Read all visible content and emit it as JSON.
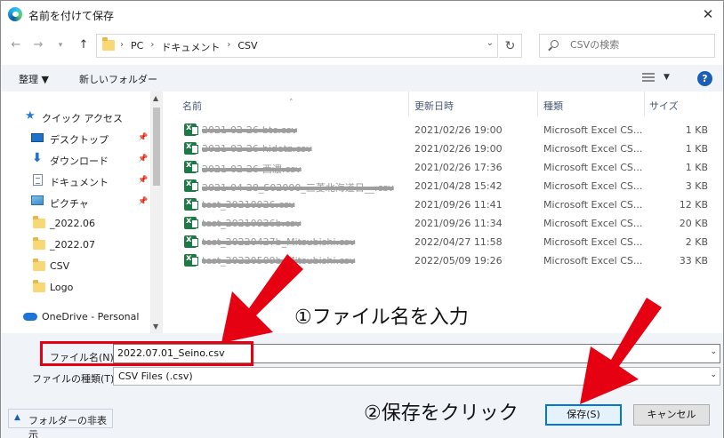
{
  "window": {
    "title": "名前を付けて保存"
  },
  "address": {
    "crumbs": [
      "PC",
      "ドキュメント",
      "CSV"
    ]
  },
  "search": {
    "placeholder": "CSVの検索"
  },
  "toolbar": {
    "organize": "整理 ▼",
    "new_folder": "新しいフォルダー"
  },
  "nav": {
    "quick_access": "クイック アクセス",
    "items": [
      {
        "label": "デスクトップ",
        "icon": "desktop-icon",
        "pinned": true
      },
      {
        "label": "ダウンロード",
        "icon": "download-icon",
        "pinned": true
      },
      {
        "label": "ドキュメント",
        "icon": "document-icon",
        "pinned": true
      },
      {
        "label": "ピクチャ",
        "icon": "pictures-icon",
        "pinned": true
      },
      {
        "label": "_2022.06",
        "icon": "folder-icon",
        "pinned": false
      },
      {
        "label": "_2022.07",
        "icon": "folder-icon",
        "pinned": false
      },
      {
        "label": "CSV",
        "icon": "folder-icon",
        "pinned": false
      },
      {
        "label": "Logo",
        "icon": "folder-icon",
        "pinned": false
      }
    ],
    "onedrive": "OneDrive - Personal"
  },
  "columns": {
    "name": "名前",
    "date": "更新日時",
    "type": "種類",
    "size": "サイズ"
  },
  "files": [
    {
      "name": "2021-02-26-btc.csv",
      "date": "2021/02/26 19:00",
      "type": "Microsoft Excel CS...",
      "size": "1 KB"
    },
    {
      "name": "2021-02-26-hidetz.csv",
      "date": "2021/02/26 19:00",
      "type": "Microsoft Excel CS...",
      "size": "1 KB"
    },
    {
      "name": "2021-02-26-西濃.csv",
      "date": "2021/02/26 17:36",
      "type": "Microsoft Excel CS...",
      "size": "1 KB"
    },
    {
      "name": "2021-04-28_S02000_三菱北海道日__.csv",
      "date": "2021/04/28 15:42",
      "type": "Microsoft Excel CS...",
      "size": "3 KB"
    },
    {
      "name": "test_20210926.csv",
      "date": "2021/09/26 11:41",
      "type": "Microsoft Excel CS...",
      "size": "12 KB"
    },
    {
      "name": "test_20210926b.csv",
      "date": "2021/09/26 11:34",
      "type": "Microsoft Excel CS...",
      "size": "20 KB"
    },
    {
      "name": "test_20220427b_Mitsubishi.csv",
      "date": "2022/04/27 11:58",
      "type": "Microsoft Excel CS...",
      "size": "2 KB"
    },
    {
      "name": "test_20220509b_Mitsubishi.csv",
      "date": "2022/05/09 19:26",
      "type": "Microsoft Excel CS...",
      "size": "33 KB"
    }
  ],
  "form": {
    "filename_label": "ファイル名(N):",
    "filename_value": "2022.07.01_Seino.csv",
    "filetype_label": "ファイルの種類(T):",
    "filetype_value": "CSV Files (.csv)"
  },
  "buttons": {
    "hide_folders": "フォルダーの非表示",
    "save": "保存(S)",
    "cancel": "キャンセル"
  },
  "annotations": {
    "step1": "①ファイル名を入力",
    "step2": "②保存をクリック",
    "arrow_color": "#e50012"
  }
}
